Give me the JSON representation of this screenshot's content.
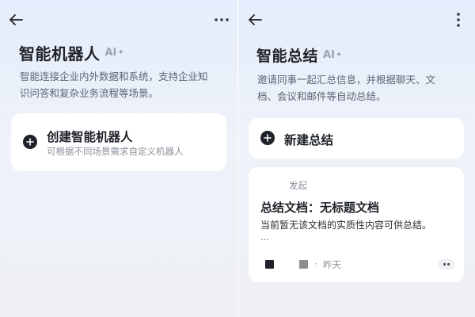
{
  "left_panel": {
    "title": "智能机器人",
    "ai_label": "AI",
    "ai_spark": "✦",
    "description_line1": "智能连接企业内外数据和系统，支持企业知",
    "description_line2": "识问答和复杂业务流程等场景。",
    "create_card": {
      "title": "创建智能机器人",
      "subtitle": "可根据不同场景需求自定义机器人"
    }
  },
  "right_panel": {
    "title": "智能总结",
    "ai_label": "AI",
    "ai_spark": "✦",
    "description_line1": "邀请同事一起汇总信息，并根据聊天、文",
    "description_line2": "档、会议和邮件等自动总结。",
    "new_card": {
      "title": "新建总结"
    },
    "summary_card": {
      "initiated_label": "发起",
      "title": "总结文档：无标题文档",
      "body": "当前暂无该文档的实质性内容可供总结。",
      "ellipsis": "...",
      "separator": "·",
      "time": "昨天"
    }
  },
  "colors": {
    "text_primary": "#1f2329",
    "text_secondary": "#5d6470",
    "text_muted": "#8a919c",
    "ai_badge": "#9aa3b2",
    "card_bg": "#ffffff"
  }
}
